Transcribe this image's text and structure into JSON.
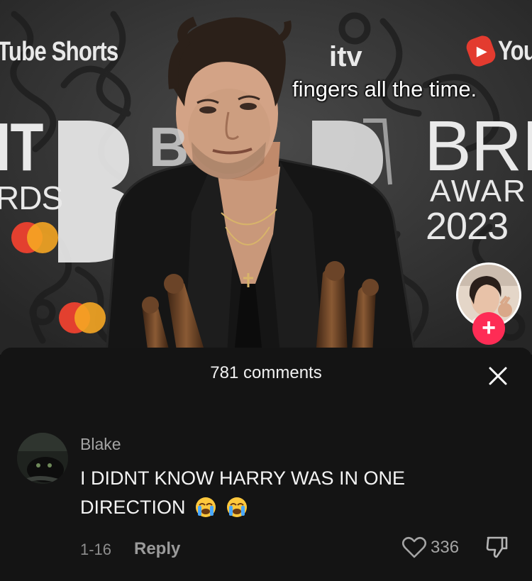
{
  "video": {
    "yt_shorts_left": "Tube Shorts",
    "itv_logo": "itv",
    "yt_right_word": "You",
    "brit_left": "IT",
    "awards_left": "RDS",
    "brit_mid": "B",
    "brit_right": "BRI",
    "awards_right": "AWAR",
    "year_right": "2023",
    "subtitle": "fingers all the time.",
    "follow_label": "+"
  },
  "comments": {
    "title": "781 comments",
    "items": [
      {
        "user": "Blake",
        "text": "I DIDNT KNOW HARRY WAS IN ONE DIRECTION",
        "emojis": [
          "loudly-crying-face",
          "loudly-crying-face"
        ],
        "date": "1-16",
        "reply_label": "Reply",
        "likes": "336"
      }
    ]
  },
  "icons": {
    "close": "close-icon",
    "like": "heart-outline-icon",
    "dislike": "thumbs-down-icon"
  },
  "colors": {
    "panel_bg": "#141414",
    "accent_pink": "#fe2c55",
    "text_primary": "#f4f4f4",
    "text_secondary": "#a4a4a4"
  }
}
